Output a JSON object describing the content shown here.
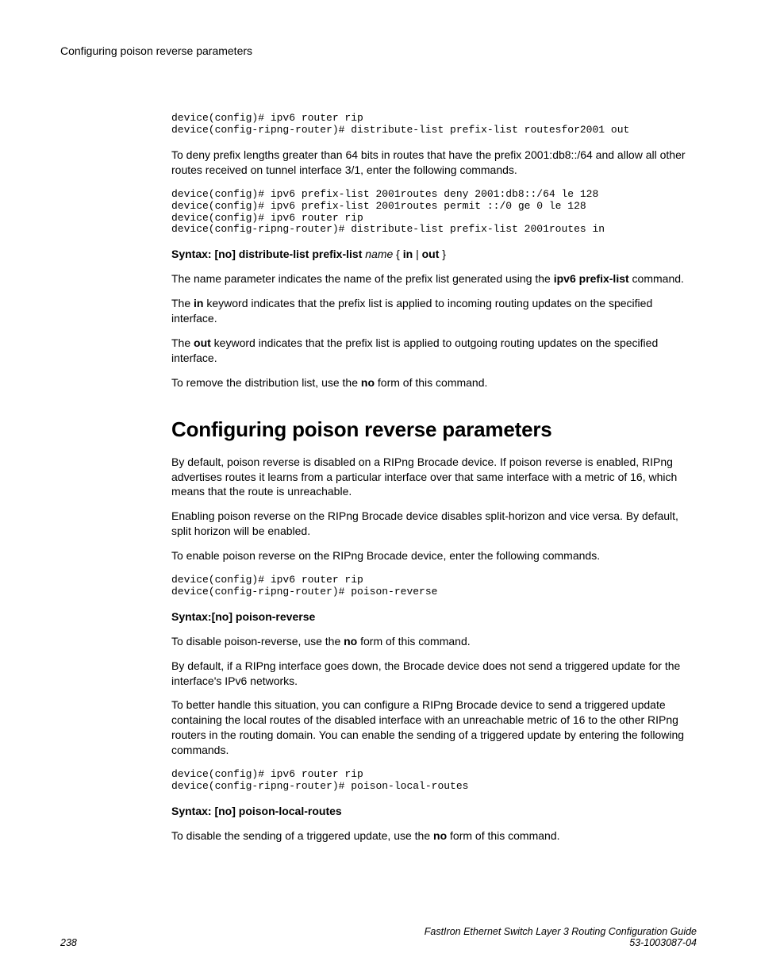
{
  "header": {
    "title": "Configuring poison reverse parameters"
  },
  "code1": "device(config)# ipv6 router rip\ndevice(config-ripng-router)# distribute-list prefix-list routesfor2001 out",
  "para1": "To deny prefix lengths greater than 64 bits in routes that have the prefix 2001:db8::/64 and allow all other routes received on tunnel interface 3/1, enter the following commands.",
  "code2": "device(config)# ipv6 prefix-list 2001routes deny 2001:db8::/64 le 128\ndevice(config)# ipv6 prefix-list 2001routes permit ::/0 ge 0 le 128\ndevice(config)# ipv6 router rip\ndevice(config-ripng-router)# distribute-list prefix-list 2001routes in",
  "syntax1_prefix": "Syntax: [no] distribute-list prefix-list",
  "syntax1_name": "name",
  "syntax1_brace_open": "{",
  "syntax1_in": "in",
  "syntax1_pipe": "|",
  "syntax1_out": "out",
  "syntax1_brace_close": "}",
  "para2_a": "The name parameter indicates the name of the prefix list generated using the ",
  "para2_b": "ipv6 prefix-list",
  "para2_c": " command.",
  "para3_a": "The ",
  "para3_b": "in",
  "para3_c": " keyword indicates that the prefix list is applied to incoming routing updates on the specified interface.",
  "para4_a": "The ",
  "para4_b": "out",
  "para4_c": " keyword indicates that the prefix list is applied to outgoing routing updates on the specified interface.",
  "para5_a": "To remove the distribution list, use the ",
  "para5_b": "no",
  "para5_c": " form of this command.",
  "section_heading": "Configuring poison reverse parameters",
  "para6": "By default, poison reverse is disabled on a RIPng Brocade device. If poison reverse is enabled, RIPng advertises routes it learns from a particular interface over that same interface with a metric of 16, which means that the route is unreachable.",
  "para7": "Enabling poison reverse on the RIPng Brocade device disables split-horizon and vice versa. By default, split horizon will be enabled.",
  "para8": "To enable poison reverse on the RIPng Brocade device, enter the following commands.",
  "code3": "device(config)# ipv6 router rip\ndevice(config-ripng-router)# poison-reverse",
  "syntax2": "Syntax:[no] poison-reverse",
  "para9_a": "To disable poison-reverse, use the ",
  "para9_b": "no",
  "para9_c": " form of this command.",
  "para10": "By default, if a RIPng interface goes down, the Brocade device does not send a triggered update for the interface's IPv6 networks.",
  "para11": "To better handle this situation, you can configure a RIPng Brocade device to send a triggered update containing the local routes of the disabled interface with an unreachable metric of 16 to the other RIPng routers in the routing domain. You can enable the sending of a triggered update by entering the following commands.",
  "code4": "device(config)# ipv6 router rip\ndevice(config-ripng-router)# poison-local-routes",
  "syntax3": "Syntax: [no] poison-local-routes",
  "para12_a": "To disable the sending of a triggered update, use the ",
  "para12_b": "no",
  "para12_c": " form of this command.",
  "footer": {
    "page_number": "238",
    "doc_title": "FastIron Ethernet Switch Layer 3 Routing Configuration Guide",
    "doc_id": "53-1003087-04"
  }
}
